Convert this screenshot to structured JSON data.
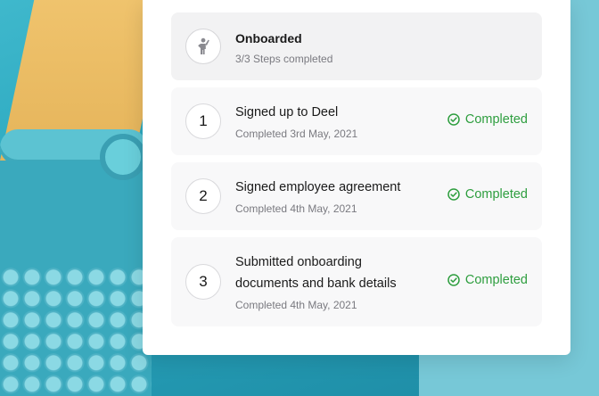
{
  "colors": {
    "accent_green": "#2e9e3f",
    "card_bg": "#ffffff",
    "header_bg": "#f2f2f3",
    "item_bg": "#f8f8f9",
    "muted_text": "#7a7a80"
  },
  "header": {
    "icon": "person-waving-icon",
    "title": "Onboarded",
    "subtitle": "3/3 Steps completed"
  },
  "steps": [
    {
      "number": "1",
      "title": "Signed up to Deel",
      "subtitle": "Completed 3rd May, 2021",
      "status": "Completed",
      "status_icon": "check-circle-icon"
    },
    {
      "number": "2",
      "title": "Signed employee agreement",
      "subtitle": "Completed 4th May, 2021",
      "status": "Completed",
      "status_icon": "check-circle-icon"
    },
    {
      "number": "3",
      "title": "Submitted onboarding documents and bank details",
      "subtitle": "Completed 4th May, 2021",
      "status": "Completed",
      "status_icon": "check-circle-icon"
    }
  ]
}
